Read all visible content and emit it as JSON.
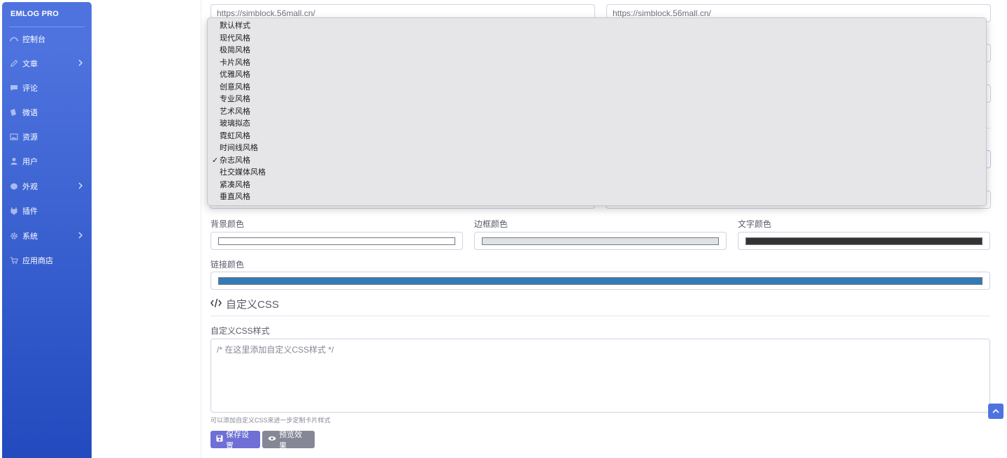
{
  "sidebar": {
    "brand": "EMLOG PRO",
    "items": [
      {
        "label": "控制台",
        "icon": "dashboard-icon",
        "has_arrow": false
      },
      {
        "label": "文章",
        "icon": "pencil-icon",
        "has_arrow": true
      },
      {
        "label": "评论",
        "icon": "comment-icon",
        "has_arrow": false
      },
      {
        "label": "微语",
        "icon": "note-icon",
        "has_arrow": false
      },
      {
        "label": "资源",
        "icon": "image-icon",
        "has_arrow": false
      },
      {
        "label": "用户",
        "icon": "user-icon",
        "has_arrow": false
      },
      {
        "label": "外观",
        "icon": "palette-icon",
        "has_arrow": true
      },
      {
        "label": "插件",
        "icon": "plug-icon",
        "has_arrow": false
      },
      {
        "label": "系统",
        "icon": "gear-icon",
        "has_arrow": true
      },
      {
        "label": "应用商店",
        "icon": "cart-icon",
        "has_arrow": false
      }
    ]
  },
  "form": {
    "url_left": "https://simblock.56mall.cn/",
    "url_right": "https://simblock.56mall.cn/",
    "colors": {
      "bg_label": "背景颜色",
      "bg_value": "#ffffff",
      "border_label": "边框颜色",
      "border_value": "#dee2e6",
      "text_label": "文字颜色",
      "text_value": "#333333",
      "link_label": "链接颜色",
      "link_value": "#337ab7"
    },
    "css_section_title": "自定义CSS",
    "css_label": "自定义CSS样式",
    "css_placeholder": "/* 在这里添加自定义CSS样式 */",
    "css_help": "可以添加自定义CSS来进一步定制卡片样式",
    "save_label": "保存设置",
    "preview_label": "预览效果"
  },
  "dropdown": {
    "selected": "杂志风格",
    "options": [
      "默认样式",
      "现代风格",
      "极简风格",
      "卡片风格",
      "优雅风格",
      "创意风格",
      "专业风格",
      "艺术风格",
      "玻璃拟态",
      "霓虹风格",
      "时间线风格",
      "杂志风格",
      "社交媒体风格",
      "紧凑风格",
      "垂直风格"
    ]
  }
}
